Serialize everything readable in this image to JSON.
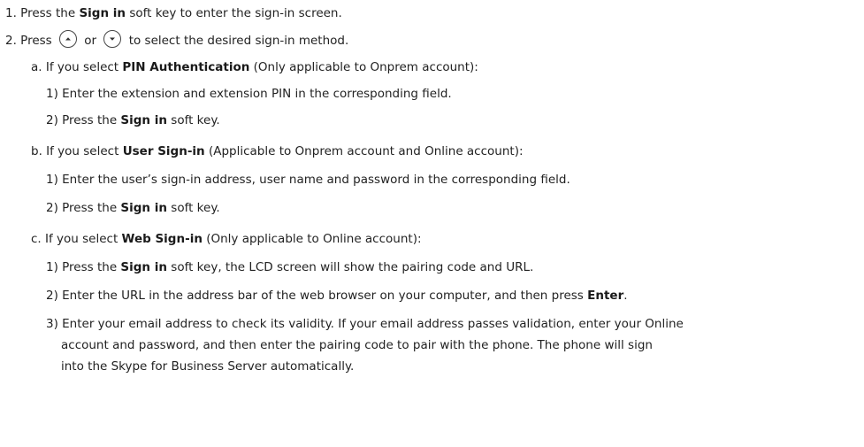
{
  "steps": {
    "s1": {
      "num": "1. Press the ",
      "bold": "Sign in",
      "rest": " soft key to enter the sign-in screen."
    },
    "s2": {
      "num": "2. Press ",
      "up_icon": "up-arrow-key-icon",
      "or": " or ",
      "down_icon": "down-arrow-key-icon",
      "rest": " to select the desired sign-in method."
    },
    "a": {
      "prefix": "a. If you select ",
      "bold": "PIN Authentication",
      "rest": " (Only applicable to Onprem account):",
      "step1": "1) Enter the extension and extension PIN in the corresponding field.",
      "step2_prefix": "2) Press the ",
      "step2_bold": "Sign in",
      "step2_rest": " soft key."
    },
    "b": {
      "prefix": "b. If you select ",
      "bold": "User Sign-in",
      "rest": " (Applicable to Onprem account and Online account):",
      "step1": "1) Enter the user’s sign-in address, user name and password in the corresponding field.",
      "step2_prefix": "2) Press the ",
      "step2_bold": "Sign in",
      "step2_rest": " soft key."
    },
    "c": {
      "prefix": "c. If you select ",
      "bold": "Web Sign-in",
      "rest": " (Only applicable to Online account):",
      "step1_prefix": "1) Press the ",
      "step1_bold": "Sign in",
      "step1_rest": " soft key, the LCD screen will show the pairing code and URL.",
      "step2_prefix": "2) Enter the URL in the address bar of the web browser on your computer, and then press ",
      "step2_bold": "Enter",
      "step2_rest": ".",
      "step3_line1": "3) Enter your email address to check its validity. If your email address passes validation, enter your Online",
      "step3_line2": "account and password, and then enter the pairing code to pair with the phone. The phone will sign",
      "step3_line3": "into the Skype for Business Server automatically."
    }
  }
}
